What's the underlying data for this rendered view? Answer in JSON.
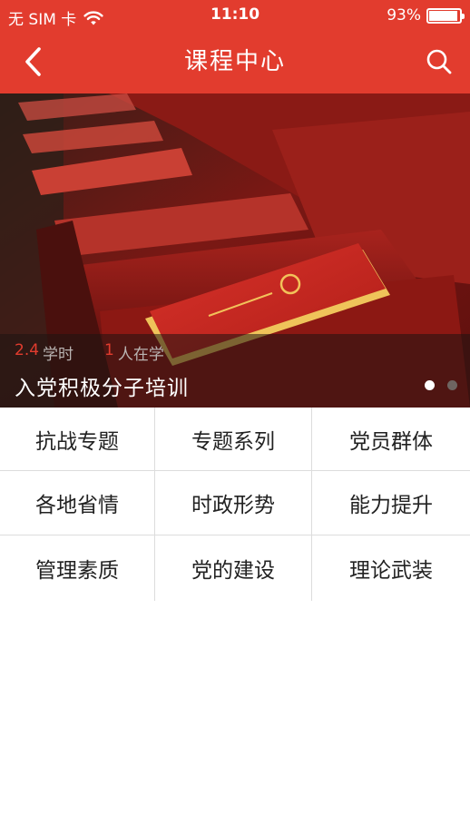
{
  "status_bar": {
    "carrier": "无 SIM 卡",
    "time": "11:10",
    "battery_percent": "93%",
    "battery_level": 0.93,
    "wifi_icon": "wifi-icon"
  },
  "navbar": {
    "title": "课程中心",
    "back_icon": "chevron-left-icon",
    "search_icon": "search-icon",
    "background": "#e23c2e"
  },
  "banner": {
    "hours_value": "2.4",
    "hours_label": "学时",
    "learners_value": "1",
    "learners_label": "人在学",
    "title": "入党积极分子培训",
    "page_count": 2,
    "active_page": 1
  },
  "categories": [
    "抗战专题",
    "专题系列",
    "党员群体",
    "各地省情",
    "时政形势",
    "能力提升",
    "管理素质",
    "党的建设",
    "理论武装"
  ],
  "colors": {
    "accent": "#e23c2e",
    "grid_border": "#dcdcdc",
    "text": "#222222"
  }
}
